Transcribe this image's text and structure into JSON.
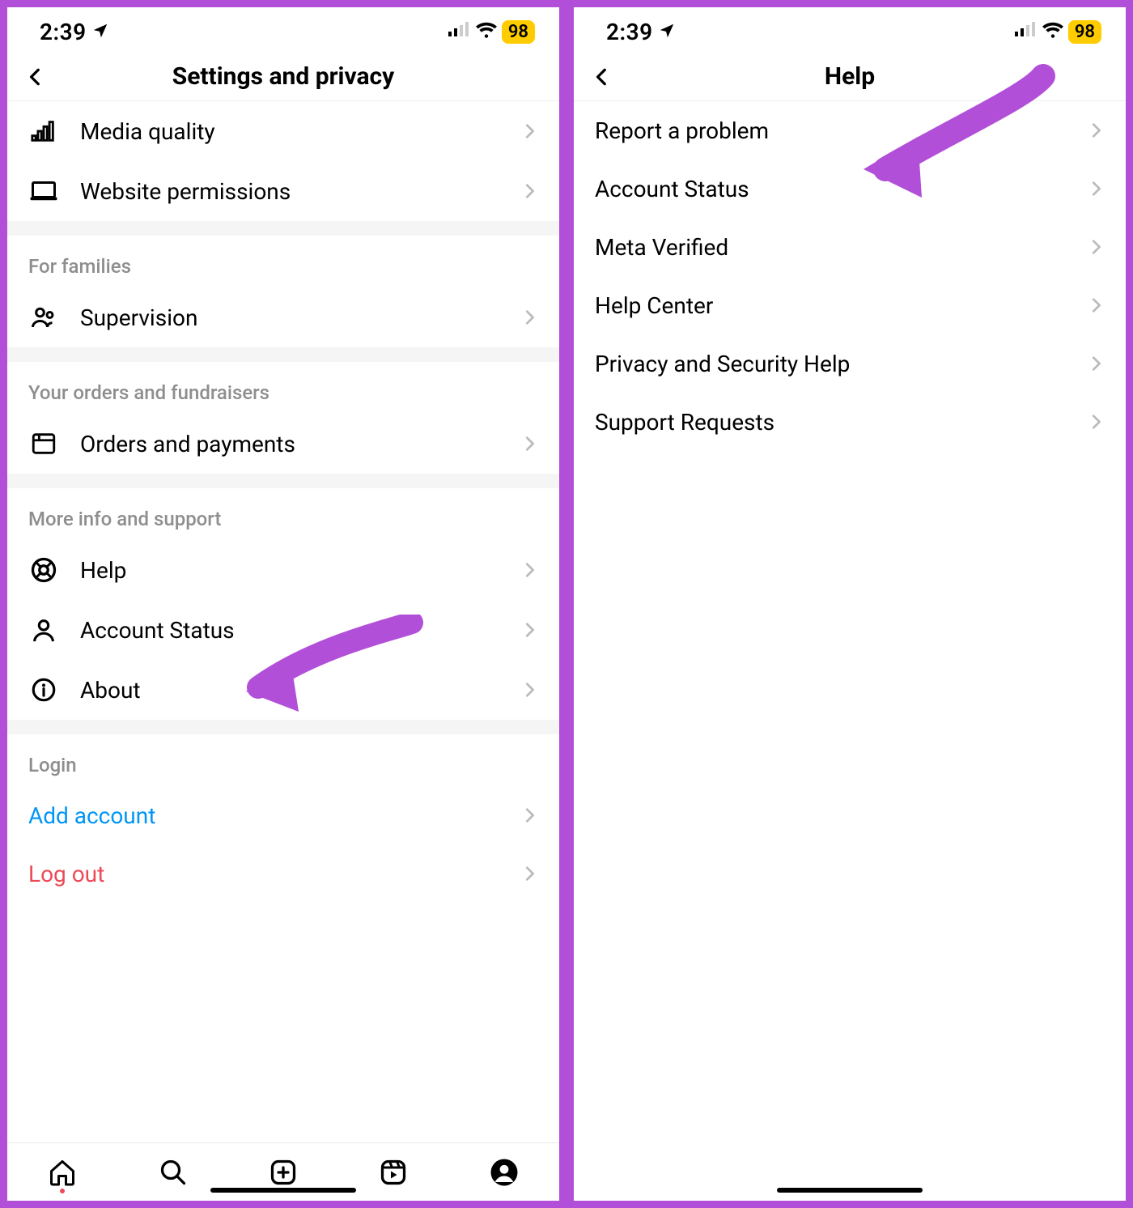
{
  "status": {
    "time": "2:39",
    "battery": "98"
  },
  "panelA": {
    "title": "Settings and privacy",
    "topRows": [
      {
        "label": "Media quality",
        "icon": "signal-icon"
      },
      {
        "label": "Website permissions",
        "icon": "laptop-icon"
      }
    ],
    "sections": [
      {
        "header": "For families",
        "rows": [
          {
            "label": "Supervision",
            "icon": "people-icon"
          }
        ]
      },
      {
        "header": "Your orders and fundraisers",
        "rows": [
          {
            "label": "Orders and payments",
            "icon": "box-icon"
          }
        ]
      },
      {
        "header": "More info and support",
        "rows": [
          {
            "label": "Help",
            "icon": "lifebuoy-icon"
          },
          {
            "label": "Account Status",
            "icon": "person-icon"
          },
          {
            "label": "About",
            "icon": "info-icon"
          }
        ]
      },
      {
        "header": "Login",
        "rows": [
          {
            "label": "Add account",
            "style": "blue"
          },
          {
            "label": "Log out",
            "style": "red"
          }
        ]
      }
    ]
  },
  "panelB": {
    "title": "Help",
    "rows": [
      {
        "label": "Report a problem"
      },
      {
        "label": "Account Status"
      },
      {
        "label": "Meta Verified"
      },
      {
        "label": "Help Center"
      },
      {
        "label": "Privacy and Security Help"
      },
      {
        "label": "Support Requests"
      }
    ]
  }
}
